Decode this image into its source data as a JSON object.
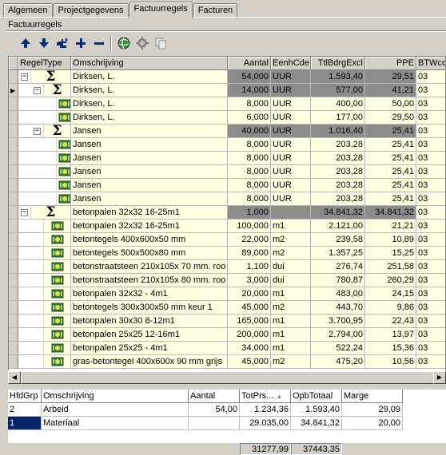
{
  "tabs": [
    "Algemeen",
    "Projectgegevens",
    "Factuurregels",
    "Facturen"
  ],
  "active_tab": 2,
  "section_title": "Factuurregels",
  "toolbar": {
    "buttons": [
      "move-up-icon",
      "move-down-icon",
      "add-sub-icon",
      "add-icon",
      "remove-icon",
      "globe-icon",
      "gear-icon",
      "copy-icon"
    ]
  },
  "grid": {
    "columns": [
      "RegelType",
      "Omschrijving",
      "Aantal",
      "EenhCde",
      "TtlBdrgExcl",
      "PPE",
      "BTWcod"
    ],
    "rows": [
      {
        "level": 0,
        "sum": true,
        "exp": "-",
        "oms": "Dirksen, L.",
        "aantal": "54,000",
        "eenh": "UUR",
        "ttl": "1.593,40",
        "ppe": "29,51",
        "btw": "03"
      },
      {
        "level": 1,
        "sum": true,
        "exp": "-",
        "cur": true,
        "oms": "Dirksen, L.",
        "aantal": "14,000",
        "eenh": "UUR",
        "ttl": "577,00",
        "ppe": "41,21",
        "btw": "03"
      },
      {
        "level": 2,
        "sum": false,
        "oms": "Dirksen, L.",
        "aantal": "8,000",
        "eenh": "UUR",
        "ttl": "400,00",
        "ppe": "50,00",
        "btw": "03"
      },
      {
        "level": 2,
        "sum": false,
        "oms": "Dirksen, L.",
        "aantal": "6,000",
        "eenh": "UUR",
        "ttl": "177,00",
        "ppe": "29,50",
        "btw": "03"
      },
      {
        "level": 1,
        "sum": true,
        "exp": "-",
        "oms": "Jansen",
        "aantal": "40,000",
        "eenh": "UUR",
        "ttl": "1.016,40",
        "ppe": "25,41",
        "btw": "03"
      },
      {
        "level": 2,
        "sum": false,
        "oms": "Jansen",
        "aantal": "8,000",
        "eenh": "UUR",
        "ttl": "203,28",
        "ppe": "25,41",
        "btw": "03"
      },
      {
        "level": 2,
        "sum": false,
        "oms": "Jansen",
        "aantal": "8,000",
        "eenh": "UUR",
        "ttl": "203,28",
        "ppe": "25,41",
        "btw": "03"
      },
      {
        "level": 2,
        "sum": false,
        "oms": "Jansen",
        "aantal": "8,000",
        "eenh": "UUR",
        "ttl": "203,28",
        "ppe": "25,41",
        "btw": "03"
      },
      {
        "level": 2,
        "sum": false,
        "oms": "Jansen",
        "aantal": "8,000",
        "eenh": "UUR",
        "ttl": "203,28",
        "ppe": "25,41",
        "btw": "03"
      },
      {
        "level": 2,
        "sum": false,
        "oms": "Jansen",
        "aantal": "8,000",
        "eenh": "UUR",
        "ttl": "203,28",
        "ppe": "25,41",
        "btw": "03"
      },
      {
        "level": 0,
        "sum": true,
        "exp": "-",
        "oms": "betonpalen 32x32 16-25m1",
        "aantal": "1,000",
        "eenh": "",
        "ttl": "34.841,32",
        "ppe": "34.841,32",
        "btw": "03"
      },
      {
        "level": 1,
        "sum": false,
        "oms": "betonpalen 32x32 16-25m1",
        "aantal": "100,000",
        "eenh": "m1",
        "ttl": "2.121,00",
        "ppe": "21,21",
        "btw": "03"
      },
      {
        "level": 1,
        "sum": false,
        "oms": "betontegels 400x600x50 mm",
        "aantal": "22,000",
        "eenh": "m2",
        "ttl": "239,58",
        "ppe": "10,89",
        "btw": "03"
      },
      {
        "level": 1,
        "sum": false,
        "oms": "betontegels 500x500x80 mm",
        "aantal": "89,000",
        "eenh": "m2",
        "ttl": "1.357,25",
        "ppe": "15,25",
        "btw": "03"
      },
      {
        "level": 1,
        "sum": false,
        "oms": "betonstraatsteen 210x105x 70 mm. roo",
        "aantal": "1,100",
        "eenh": "dui",
        "ttl": "276,74",
        "ppe": "251,58",
        "btw": "03"
      },
      {
        "level": 1,
        "sum": false,
        "oms": "betonstraatsteen 210x105x 80 mm. roo",
        "aantal": "3,000",
        "eenh": "dui",
        "ttl": "780,87",
        "ppe": "260,29",
        "btw": "03"
      },
      {
        "level": 1,
        "sum": false,
        "oms": "betonpalen 32x32  - 4m1",
        "aantal": "20,000",
        "eenh": "m1",
        "ttl": "483,00",
        "ppe": "24,15",
        "btw": "03"
      },
      {
        "level": 1,
        "sum": false,
        "oms": "betontegels 300x300x50 mm keur 1",
        "aantal": "45,000",
        "eenh": "m2",
        "ttl": "443,70",
        "ppe": "9,86",
        "btw": "03"
      },
      {
        "level": 1,
        "sum": false,
        "oms": "betonpalen 30x30  8-12m1",
        "aantal": "165,000",
        "eenh": "m1",
        "ttl": "3.700,95",
        "ppe": "22,43",
        "btw": "03"
      },
      {
        "level": 1,
        "sum": false,
        "oms": "betonpalen 25x25 12-16m1",
        "aantal": "200,000",
        "eenh": "m1",
        "ttl": "2.794,00",
        "ppe": "13,97",
        "btw": "03"
      },
      {
        "level": 1,
        "sum": false,
        "oms": "betonpalen 25x25  - 4m1",
        "aantal": "34,000",
        "eenh": "m1",
        "ttl": "522,24",
        "ppe": "15,36",
        "btw": "03"
      },
      {
        "level": 1,
        "sum": false,
        "oms": "gras-betontegel 400x600x 90 mm grijs",
        "aantal": "45,000",
        "eenh": "m2",
        "ttl": "475,20",
        "ppe": "10,56",
        "btw": "03"
      }
    ]
  },
  "summary": {
    "columns": [
      "HfdGrp",
      "Omschrijving",
      "Aantal",
      "TotPrs...",
      "OpbTotaal",
      "Marge"
    ],
    "rows": [
      {
        "grp": "2",
        "oms": "Arbeid",
        "aantal": "54,00",
        "tot": "1.234,36",
        "opb": "1.593,40",
        "marge": "29,09"
      },
      {
        "grp": "1",
        "oms": "Materiaal",
        "aantal": "",
        "tot": "29.035,00",
        "opb": "34.841,32",
        "marge": "20,00",
        "selected": true
      }
    ],
    "footer_tot": "31277,99",
    "footer_opb": "37443,35"
  },
  "colors": {
    "row_bg": "#ffffe1",
    "sum_bg": "#8c8c8c",
    "selection": "#0a246a"
  }
}
